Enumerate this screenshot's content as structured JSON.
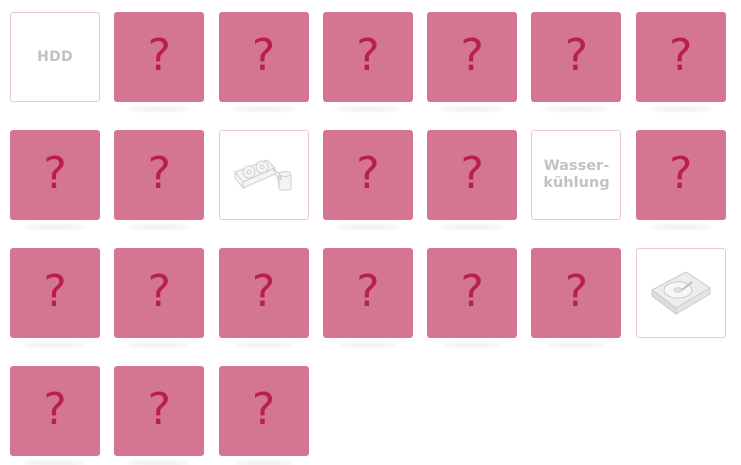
{
  "board": {
    "hidden_symbol": "?",
    "cards": [
      {
        "state": "open",
        "kind": "text",
        "text": "HDD"
      },
      {
        "state": "hidden"
      },
      {
        "state": "hidden"
      },
      {
        "state": "hidden"
      },
      {
        "state": "hidden"
      },
      {
        "state": "hidden"
      },
      {
        "state": "hidden"
      },
      {
        "state": "hidden"
      },
      {
        "state": "hidden"
      },
      {
        "state": "open",
        "kind": "image",
        "image": "water-cooling-icon"
      },
      {
        "state": "hidden"
      },
      {
        "state": "hidden"
      },
      {
        "state": "open",
        "kind": "text",
        "text": "Wasser-\nkühlung"
      },
      {
        "state": "hidden"
      },
      {
        "state": "hidden"
      },
      {
        "state": "hidden"
      },
      {
        "state": "hidden"
      },
      {
        "state": "hidden"
      },
      {
        "state": "hidden"
      },
      {
        "state": "hidden"
      },
      {
        "state": "open",
        "kind": "image",
        "image": "hard-drive-icon"
      },
      {
        "state": "hidden"
      },
      {
        "state": "hidden"
      },
      {
        "state": "hidden"
      }
    ]
  },
  "colors": {
    "card_back": "#d47591",
    "question_mark": "#b81e50",
    "open_border": "#efc7d3",
    "open_text": "#c2c2c2"
  }
}
